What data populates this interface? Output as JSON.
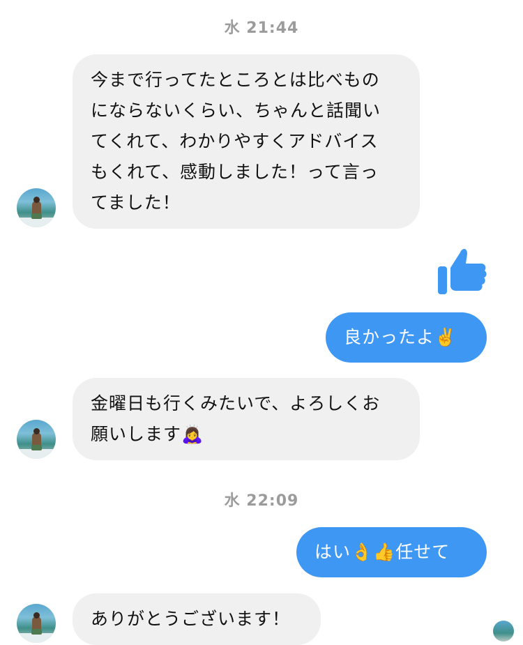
{
  "timestamps": [
    "水 21:44",
    "水 22:09"
  ],
  "messages": {
    "m1": {
      "lines": [
        "今まで行ってたところとは比べもの",
        "にならないくらい、ちゃんと話聞い",
        "てくれて、わかりやすくアドバイス",
        "もくれて、感動しました！って言っ",
        "てました！"
      ]
    },
    "m2": {
      "text": "良かったよ",
      "emoji": "✌️"
    },
    "m3": {
      "line1": "金曜日も行くみたいで、よろしくお",
      "line2": "願いします",
      "emoji": "🙇‍♀️"
    },
    "m4": {
      "text_before": "はい",
      "emoji1": "👌",
      "emoji2": "👍",
      "text_after": "任せて"
    },
    "m5": {
      "text": "ありがとうございます！"
    }
  },
  "icons": {
    "like": "thumbs-up-icon",
    "avatar": "contact-avatar"
  },
  "colors": {
    "outgoing_bubble": "#3d97f3",
    "incoming_bubble": "#f0f0f0",
    "timestamp": "#9b9b9b",
    "like": "#3d97f3"
  }
}
